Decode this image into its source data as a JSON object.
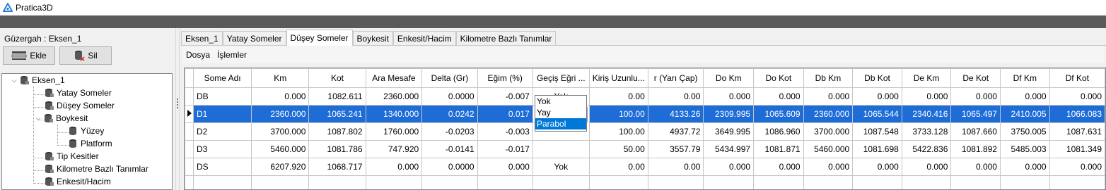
{
  "app": {
    "title": "Pratica3D"
  },
  "left_panel": {
    "route_label": "Güzergah : Eksen_1",
    "add_button": "Ekle",
    "delete_button": "Sil",
    "tree": {
      "root": "Eksen_1",
      "items": [
        "Yatay Someler",
        "Düşey Someler",
        "Boykesit",
        "Tip Kesitler",
        "Kilometre Bazlı Tanımlar",
        "Enkesit/Hacim"
      ],
      "boykesit_children": [
        "Yüzey",
        "Platform"
      ]
    }
  },
  "tabs": [
    "Eksen_1",
    "Yatay Someler",
    "Düşey Someler",
    "Boykesit",
    "Enkesit/Hacim",
    "Kilometre Bazlı Tanımlar"
  ],
  "active_tab": "Düşey Someler",
  "menu": [
    "Dosya",
    "İşlemler"
  ],
  "grid": {
    "columns": [
      "Some Adı",
      "Km",
      "Kot",
      "Ara Mesafe",
      "Delta (Gr)",
      "Eğim (%)",
      "Geçiş Eğri ...",
      "Kiriş Uzunlu...",
      "r (Yarı Çap)",
      "Do Km",
      "Do Kot",
      "Db Km",
      "Db Kot",
      "De Km",
      "De Kot",
      "Df Km",
      "Df Kot"
    ],
    "rows": [
      [
        "DB",
        "0.000",
        "1082.611",
        "2360.000",
        "0.0000",
        "-0.007",
        "Yok",
        "0.00",
        "0.00",
        "0.000",
        "0.000",
        "0.000",
        "0.000",
        "0.000",
        "0.000",
        "0.000",
        "0.000"
      ],
      [
        "D1",
        "2360.000",
        "1065.241",
        "1340.000",
        "0.0242",
        "0.017",
        "Yay",
        "100.00",
        "4133.26",
        "2309.995",
        "1065.609",
        "2360.000",
        "1065.544",
        "2340.416",
        "1065.497",
        "2410.005",
        "1066.083"
      ],
      [
        "D2",
        "3700.000",
        "1087.802",
        "1760.000",
        "-0.0203",
        "-0.003",
        "",
        "100.00",
        "4937.72",
        "3649.995",
        "1086.960",
        "3700.000",
        "1087.548",
        "3733.128",
        "1087.660",
        "3750.005",
        "1087.631"
      ],
      [
        "D3",
        "5460.000",
        "1081.786",
        "747.920",
        "-0.0141",
        "-0.017",
        "",
        "50.00",
        "3557.79",
        "5434.997",
        "1081.871",
        "5460.000",
        "1081.698",
        "5422.836",
        "1081.892",
        "5485.003",
        "1081.349"
      ],
      [
        "DS",
        "6207.920",
        "1068.717",
        "0.000",
        "0.0000",
        "0.000",
        "Yok",
        "0.00",
        "0.00",
        "0.000",
        "0.000",
        "0.000",
        "0.000",
        "0.000",
        "0.000",
        "0.000",
        "0.000"
      ]
    ],
    "selected_row": 1,
    "dropdown_options": [
      "Yok",
      "Yay",
      "Parabol"
    ],
    "dropdown_highlighted": "Parabol"
  },
  "colors": {
    "selection": "#1e6dd7",
    "dropdown_highlight": "#0078d7",
    "dark_bar": "#5a5a5a"
  }
}
